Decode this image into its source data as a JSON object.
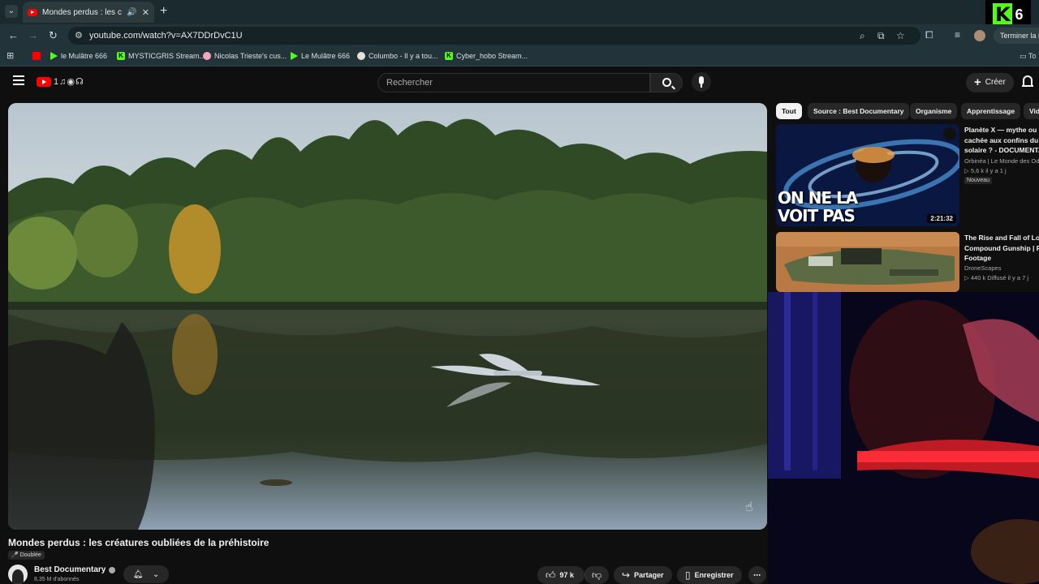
{
  "browser": {
    "tab_title": "Mondes perdus : les créatures oubliées de la préhistoire",
    "url": "youtube.com/watch?v=AX7DDrDvC1U",
    "profile_button": "Terminer la m",
    "overlay_badge_number": "6"
  },
  "bookmarks": [
    {
      "label": "",
      "icon": "youtube-icon"
    },
    {
      "label": "le Mulâtre 666",
      "icon": "play-icon"
    },
    {
      "label": "MYSTICGRIS Stream...",
      "icon": "kick-icon"
    },
    {
      "label": "Nicolas Trieste's cus...",
      "icon": "pig-icon"
    },
    {
      "label": "Le Mulâtre 666",
      "icon": "play-icon"
    },
    {
      "label": "Columbo - Il y a tou...",
      "icon": "circle-icon"
    },
    {
      "label": "Cyber_hobo Stream...",
      "icon": "kick-icon"
    }
  ],
  "bookmarks_folder": "To",
  "youtube": {
    "search_placeholder": "Rechercher",
    "create_label": "Créer"
  },
  "video": {
    "title": "Mondes perdus : les créatures oubliées de la préhistoire",
    "dubbed_label": "Doublée",
    "channel_name": "Best Documentary",
    "subscribers": "8,35 M d'abonnés",
    "likes": "97 k",
    "share_label": "Partager",
    "save_label": "Enregistrer"
  },
  "chips": [
    "Tout",
    "Source : Best Documentary",
    "Organisme",
    "Apprentissage",
    "Vid"
  ],
  "recommendations": [
    {
      "title_lines": [
        "Planète X — mythe ou ré",
        "cachée aux confins du s",
        "solaire ? - DOCUMENTA"
      ],
      "channel": "Orbinéa | Le Monde des Ody",
      "stats": "▷ 5,6 k  il y a 1 j",
      "badge": "Nouveau",
      "duration": "2:21:32",
      "thumb_text_lines": [
        "ON NE LA",
        "VOIT PAS"
      ]
    },
    {
      "title_lines": [
        "The Rise and Fall of Loc",
        "Compound Gunship | Ra",
        "Footage"
      ],
      "channel": "DroneScapes",
      "stats": "▷ 440 k  Diffusé il y a 7 j"
    }
  ]
}
